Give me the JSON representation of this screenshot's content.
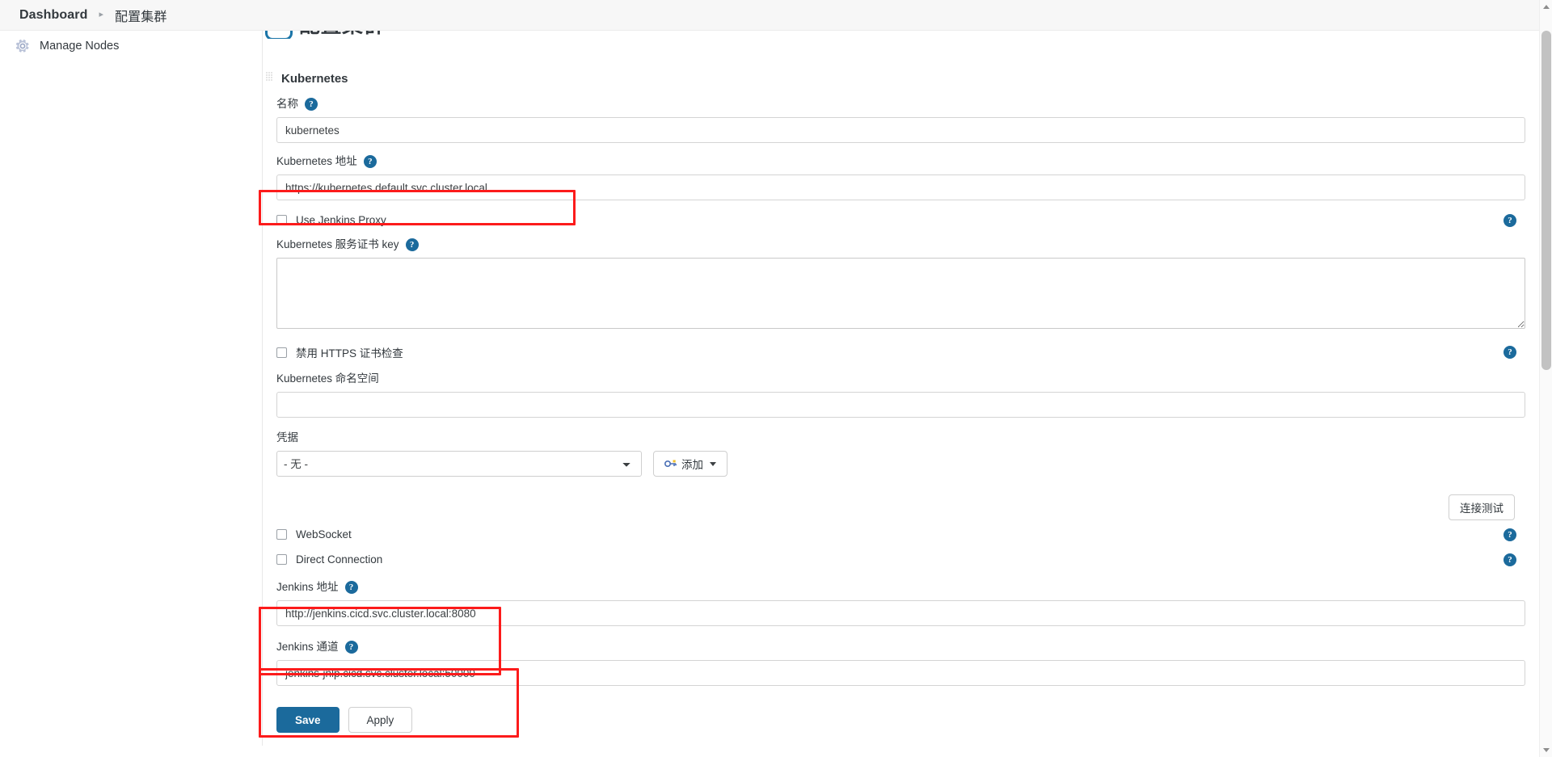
{
  "breadcrumb": {
    "items": [
      {
        "label": "Dashboard",
        "bold": true
      },
      {
        "label": "配置集群",
        "bold": false
      }
    ],
    "separator": "▸"
  },
  "sidebar": {
    "items": [
      {
        "label": "Manage Nodes",
        "icon": "gear-icon"
      }
    ]
  },
  "main": {
    "cut_off_heading": "配置集群",
    "section": {
      "title": "Kubernetes",
      "drag_handle_icon": "drag-dots-icon"
    },
    "fields": {
      "name": {
        "label": "名称",
        "help_icon": "help-icon",
        "value": "kubernetes"
      },
      "k8s_url": {
        "label": "Kubernetes 地址",
        "help_icon": "help-icon",
        "value": "https://kubernetes.default.svc.cluster.local",
        "highlighted": true
      },
      "use_jenkins_proxy": {
        "label": "Use Jenkins Proxy",
        "checked": false,
        "help_icon": "help-icon"
      },
      "server_cert_key": {
        "label": "Kubernetes 服务证书 key",
        "help_icon": "help-icon",
        "value": ""
      },
      "disable_https_check": {
        "label": "禁用 HTTPS 证书检查",
        "checked": false,
        "help_icon": "help-icon"
      },
      "namespace": {
        "label": "Kubernetes 命名空间",
        "value": ""
      },
      "credentials": {
        "label": "凭据",
        "selected": "- 无 -",
        "options": [
          "- 无 -"
        ],
        "add_button": {
          "label": "添加",
          "icon": "key-icon",
          "caret_icon": "chevron-down-icon"
        }
      },
      "test_connection_button": {
        "label": "连接测试"
      },
      "websocket": {
        "label": "WebSocket",
        "checked": false,
        "help_icon": "help-icon"
      },
      "direct_connection": {
        "label": "Direct Connection",
        "checked": false,
        "help_icon": "help-icon"
      },
      "jenkins_url": {
        "label": "Jenkins 地址",
        "help_icon": "help-icon",
        "value": "http://jenkins.cicd.svc.cluster.local:8080",
        "highlighted": true
      },
      "jenkins_tunnel": {
        "label": "Jenkins 通道",
        "help_icon": "help-icon",
        "value": "jenkins-jnlp.cicd.svc.cluster.local:50000",
        "highlighted": true
      }
    },
    "actions": {
      "save": "Save",
      "apply": "Apply"
    }
  },
  "colors": {
    "accent": "#1b6a9c",
    "annotation": "#fc1b1b",
    "help_badge": "#1b6a9c",
    "text": "#33393e",
    "border": "#d4d4d4"
  }
}
